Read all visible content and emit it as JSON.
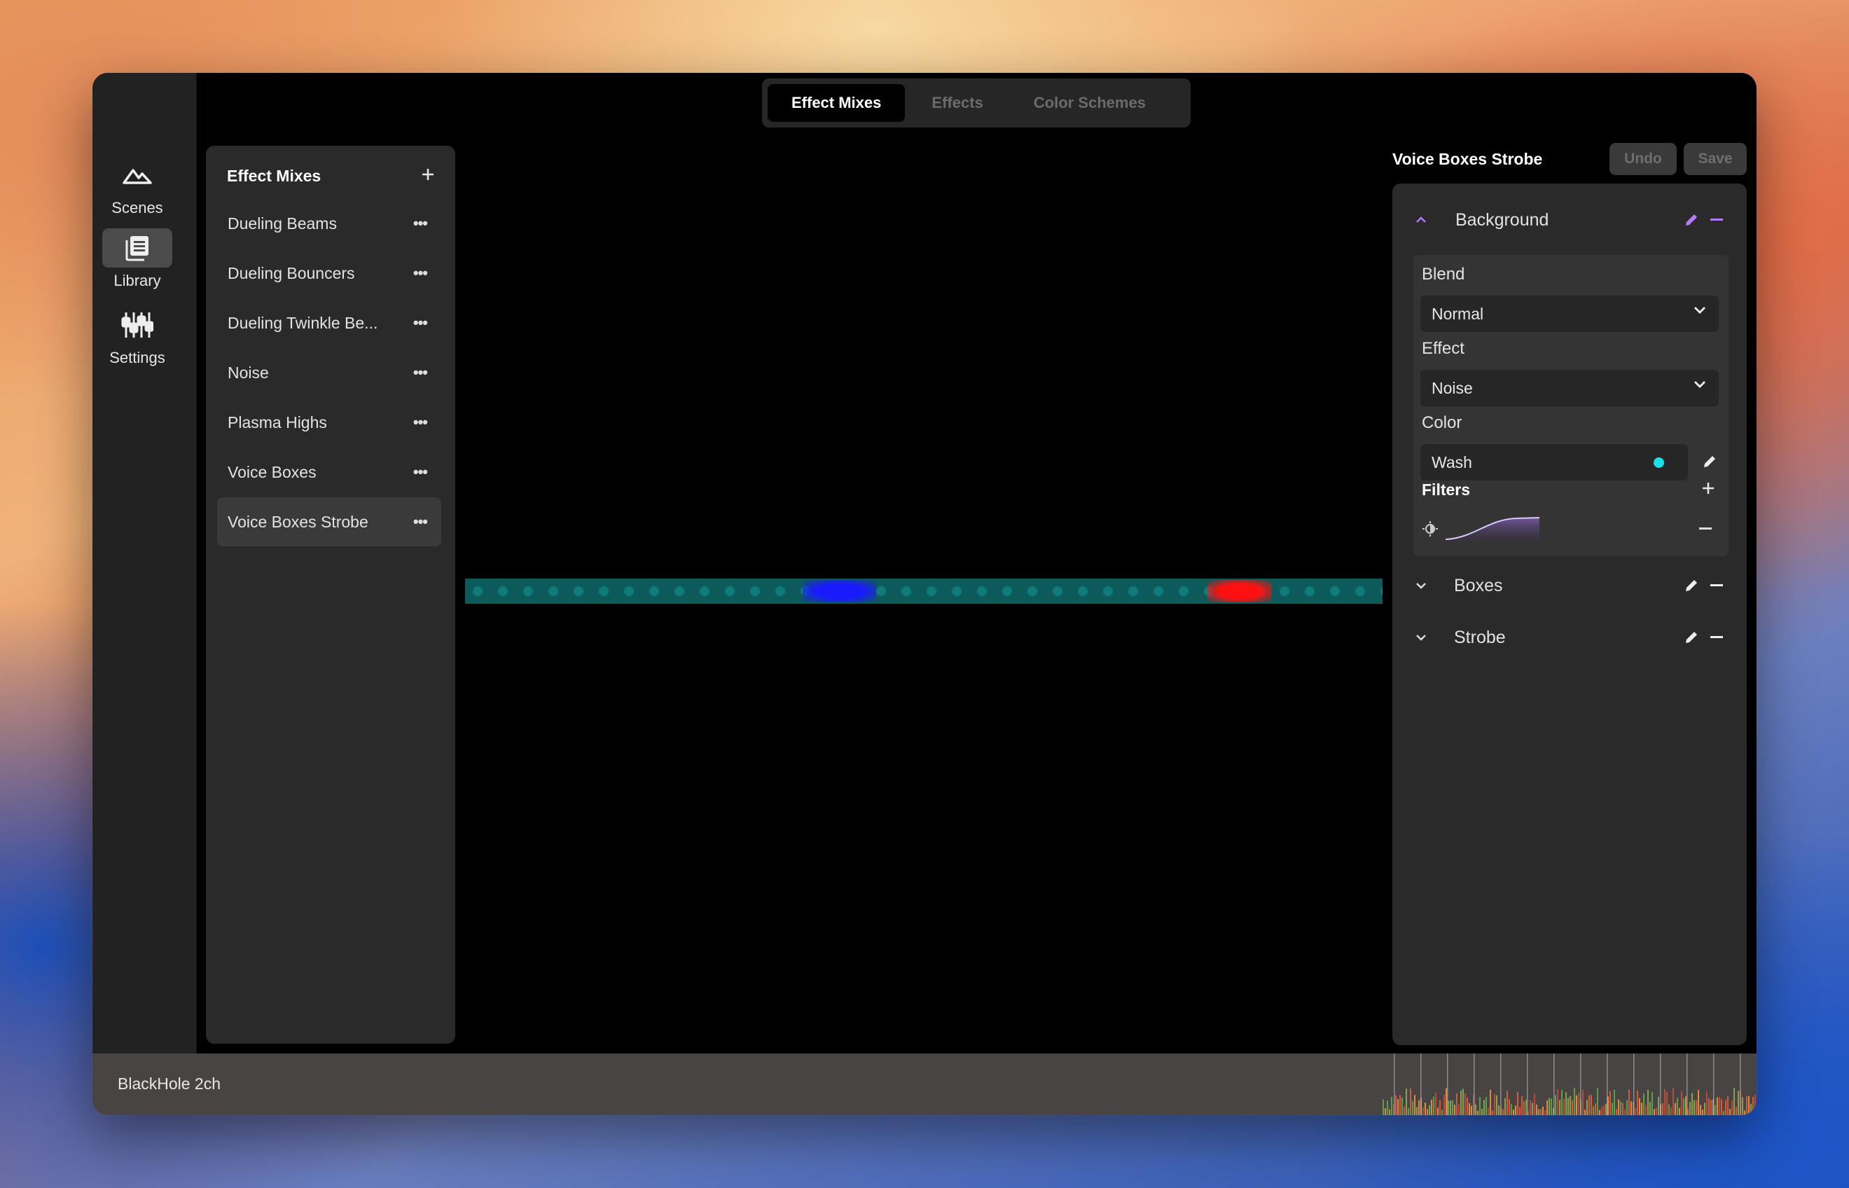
{
  "nav": {
    "items": [
      {
        "label": "Scenes",
        "icon": "mountains-icon"
      },
      {
        "label": "Library",
        "icon": "library-icon",
        "active": true
      },
      {
        "label": "Settings",
        "icon": "sliders-icon"
      }
    ]
  },
  "tabs": [
    {
      "label": "Effect Mixes",
      "active": true
    },
    {
      "label": "Effects"
    },
    {
      "label": "Color Schemes"
    }
  ],
  "library": {
    "title": "Effect Mixes",
    "add_icon": "plus-icon",
    "items": [
      {
        "label": "Dueling Beams"
      },
      {
        "label": "Dueling Bouncers"
      },
      {
        "label": "Dueling Twinkle Be..."
      },
      {
        "label": "Noise"
      },
      {
        "label": "Plasma Highs"
      },
      {
        "label": "Voice Boxes"
      },
      {
        "label": "Voice Boxes Strobe",
        "active": true
      }
    ],
    "more_label": "•••"
  },
  "preview": {
    "base_color": "#0c5a5a",
    "highlights": [
      {
        "color": "#1a1aff",
        "from": 0.4,
        "to": 0.48
      },
      {
        "color": "#ff1010",
        "from": 0.87,
        "to": 0.94
      }
    ]
  },
  "editor": {
    "title": "Voice Boxes Strobe",
    "undo_label": "Undo",
    "save_label": "Save",
    "layers": [
      {
        "name": "Background",
        "expanded": true
      },
      {
        "name": "Boxes",
        "expanded": false
      },
      {
        "name": "Strobe",
        "expanded": false
      }
    ],
    "background": {
      "blend_label": "Blend",
      "blend_value": "Normal",
      "effect_label": "Effect",
      "effect_value": "Noise",
      "color_label": "Color",
      "color_value": "Wash",
      "color_swatch": "#18e0e8",
      "filters_label": "Filters",
      "filter_icon": "brightness-icon"
    }
  },
  "status": {
    "device": "BlackHole 2ch"
  },
  "colors": {
    "accent": "#b57bff",
    "panel": "#2a2a2a"
  }
}
